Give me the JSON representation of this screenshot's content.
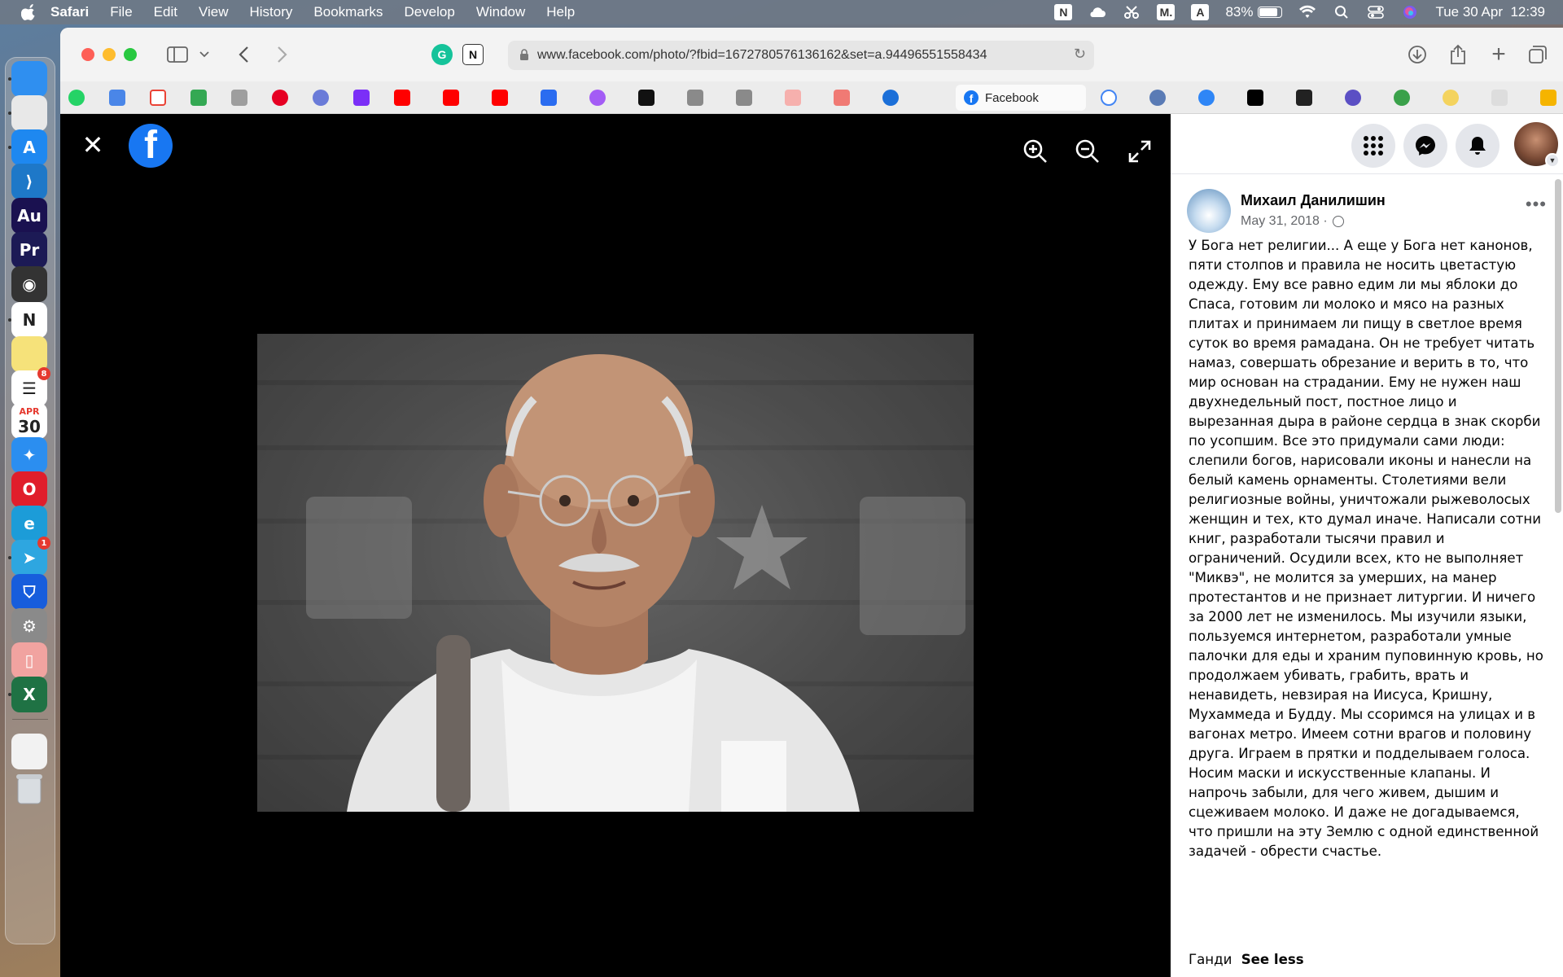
{
  "menubar": {
    "app_name": "Safari",
    "items": [
      "File",
      "Edit",
      "View",
      "History",
      "Bookmarks",
      "Develop",
      "Window",
      "Help"
    ],
    "status": {
      "notion_letter": "N",
      "m_letter": "M.",
      "a_letter": "A",
      "battery_percent": "83%",
      "battery_level": 0.83,
      "datetime": "Tue 30 Apr  12:39"
    }
  },
  "dock": {
    "apps": [
      {
        "name": "finder-icon",
        "color": "#2f8ff0",
        "glyph": ""
      },
      {
        "name": "launchpad-icon",
        "color": "#e8e8e8",
        "glyph": ""
      },
      {
        "name": "app-store-icon",
        "color": "#1e88f0",
        "glyph": "A"
      },
      {
        "name": "vscode-icon",
        "color": "#1e78c8",
        "glyph": "⟩"
      },
      {
        "name": "audition-icon",
        "color": "#1a1150",
        "glyph": "Au"
      },
      {
        "name": "premiere-icon",
        "color": "#1c1a55",
        "glyph": "Pr"
      },
      {
        "name": "obs-icon",
        "color": "#333333",
        "glyph": "◉"
      },
      {
        "name": "notion-icon",
        "color": "#ffffff",
        "glyph": "N"
      },
      {
        "name": "notes-icon",
        "color": "#f6e27a",
        "glyph": ""
      },
      {
        "name": "reminders-icon",
        "color": "#ffffff",
        "glyph": "☰"
      },
      {
        "name": "calendar-icon",
        "color": "#ffffff",
        "glyph": "30"
      },
      {
        "name": "safari-icon",
        "color": "#2b8ef0",
        "glyph": "✦"
      },
      {
        "name": "opera-icon",
        "color": "#e01e2b",
        "glyph": "O"
      },
      {
        "name": "edge-icon",
        "color": "#1c9cd8",
        "glyph": "e"
      },
      {
        "name": "telegram-icon",
        "color": "#2ea6e0",
        "glyph": "➤"
      },
      {
        "name": "bitwarden-icon",
        "color": "#175ddc",
        "glyph": "⛉"
      },
      {
        "name": "system-settings-icon",
        "color": "#8a8a8a",
        "glyph": "⚙"
      },
      {
        "name": "screen-app-icon",
        "color": "#f1a3a0",
        "glyph": "▯"
      },
      {
        "name": "excel-icon",
        "color": "#1f7244",
        "glyph": "X"
      }
    ],
    "calendar_month": "APR",
    "calendar_day": "30",
    "reminders_badge": "8",
    "telegram_badge": "1"
  },
  "browser": {
    "url": "www.facebook.com/photo/?fbid=1672780576136162&set=a.94496551558434",
    "active_tab_label": "Facebook"
  },
  "panel": {
    "author": "Михаил Данилишин",
    "date": "May 31, 2018 ·",
    "more": "•••",
    "body": "У Бога нет религии... А еще у Бога нет канонов, пяти столпов и правила не носить цветастую одежду. Ему все равно едим ли мы яблоки до Спаса, готовим ли молоко и мясо на разных плитах и принимаем ли пищу в светлое время суток во время рамадана. Он не требует читать намаз, совершать обрезание и верить в то, что мир основан на страдании. Ему не нужен наш двухнедельный пост, постное лицо и вырезанная дыра в районе сердца в знак скорби по усопшим. Все это придумали сами люди: слепили богов, нарисовали иконы и нанесли на белый камень орнаменты. Столетиями вели религиозные войны, уничтожали рыжеволосых женщин и тех, кто думал иначе. Написали сотни книг, разработали тысячи правил и ограничений. Осудили всех, кто не выполняет \"Миквэ\", не молится за умерших, на манер протестантов и не признает литургии. И ничего за 2000 лет не изменилось. Мы изучили языки, пользуемся интернетом, разработали умные палочки для еды и храним пуповинную кровь, но продолжаем убивать, грабить, врать и ненавидеть, невзирая на Иисуса, Кришну, Мухаммеда и Будду. Мы ссоримся на улицах и в вагонах метро. Имеем сотни врагов и половину друга. Играем в прятки и подделываем голоса. Носим маски и искусственные клапаны. И напрочь забыли, для чего живем, дышим и сцеживаем молоко. И даже не догадываемся, что пришли на эту Землю с одной единственной задачей - обрести счастье.",
    "signature": "Ганди",
    "see_less": "See less"
  },
  "colors": {
    "facebook_blue": "#1877f2",
    "viewer_bg": "#000000",
    "panel_bg": "#ffffff"
  }
}
